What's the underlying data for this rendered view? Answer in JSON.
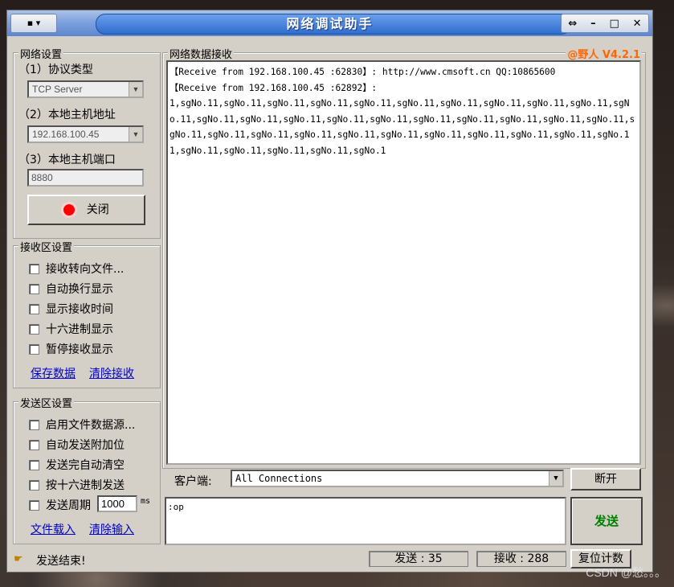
{
  "window": {
    "title": "网络调试助手",
    "sysmenu_glyph": "▪ ▾",
    "controls": {
      "pin": "⇔",
      "minimize": "–",
      "maximize": "□",
      "close": "✕"
    }
  },
  "network_settings": {
    "group_title": "网络设置",
    "protocol_label": "（1）协议类型",
    "protocol_value": "TCP Server",
    "host_label": "（2）本地主机地址",
    "host_value": "192.168.100.45",
    "port_label": "（3）本地主机端口",
    "port_value": "8880",
    "close_button": "关闭"
  },
  "receive_settings": {
    "group_title": "接收区设置",
    "options": [
      "接收转向文件...",
      "自动换行显示",
      "显示接收时间",
      "十六进制显示",
      "暂停接收显示"
    ],
    "save_link": "保存数据",
    "clear_link": "清除接收"
  },
  "send_settings": {
    "group_title": "发送区设置",
    "options": [
      "启用文件数据源...",
      "自动发送附加位",
      "发送完自动清空",
      "按十六进制发送"
    ],
    "period_label": "发送周期",
    "period_value": "1000",
    "period_unit": "ms",
    "load_link": "文件载入",
    "clear_link": "清除输入"
  },
  "receive_area": {
    "title": "网络数据接收",
    "badge": "@野人 V4.2.1",
    "line1": "【Receive from 192.168.100.45 :62830】: http://www.cmsoft.cn QQ:10865600",
    "line2": "【Receive from 192.168.100.45 :62892】:",
    "data": "1,sgNo.11,sgNo.11,sgNo.11,sgNo.11,sgNo.11,sgNo.11,sgNo.11,sgNo.11,sgNo.11,sgNo.11,sgNo.11,sgNo.11,sgNo.11,sgNo.11,sgNo.11,sgNo.11,sgNo.11,sgNo.11,sgNo.11,sgNo.11,sgNo.11,sgNo.11,sgNo.11,sgNo.11,sgNo.11,sgNo.11,sgNo.11,sgNo.11,sgNo.11,sgNo.11,sgNo.11,sgNo.11,sgNo.11,sgNo.11,sgNo.11,sgNo.11,sgNo.1"
  },
  "client": {
    "label": "客户端:",
    "value": "All Connections",
    "disconnect_button": "断开"
  },
  "send_area": {
    "text": ":op",
    "send_button": "发送"
  },
  "status": {
    "message": "发送结束!",
    "sent_label": "发送 : 35",
    "received_label": "接收 : 288",
    "reset_button": "复位计数"
  },
  "watermark": "CSDN @愁。。。",
  "colors": {
    "badge": "#ff6600",
    "link": "#0000cc",
    "send_button_text": "#008000",
    "indicator": "#ff0000"
  }
}
